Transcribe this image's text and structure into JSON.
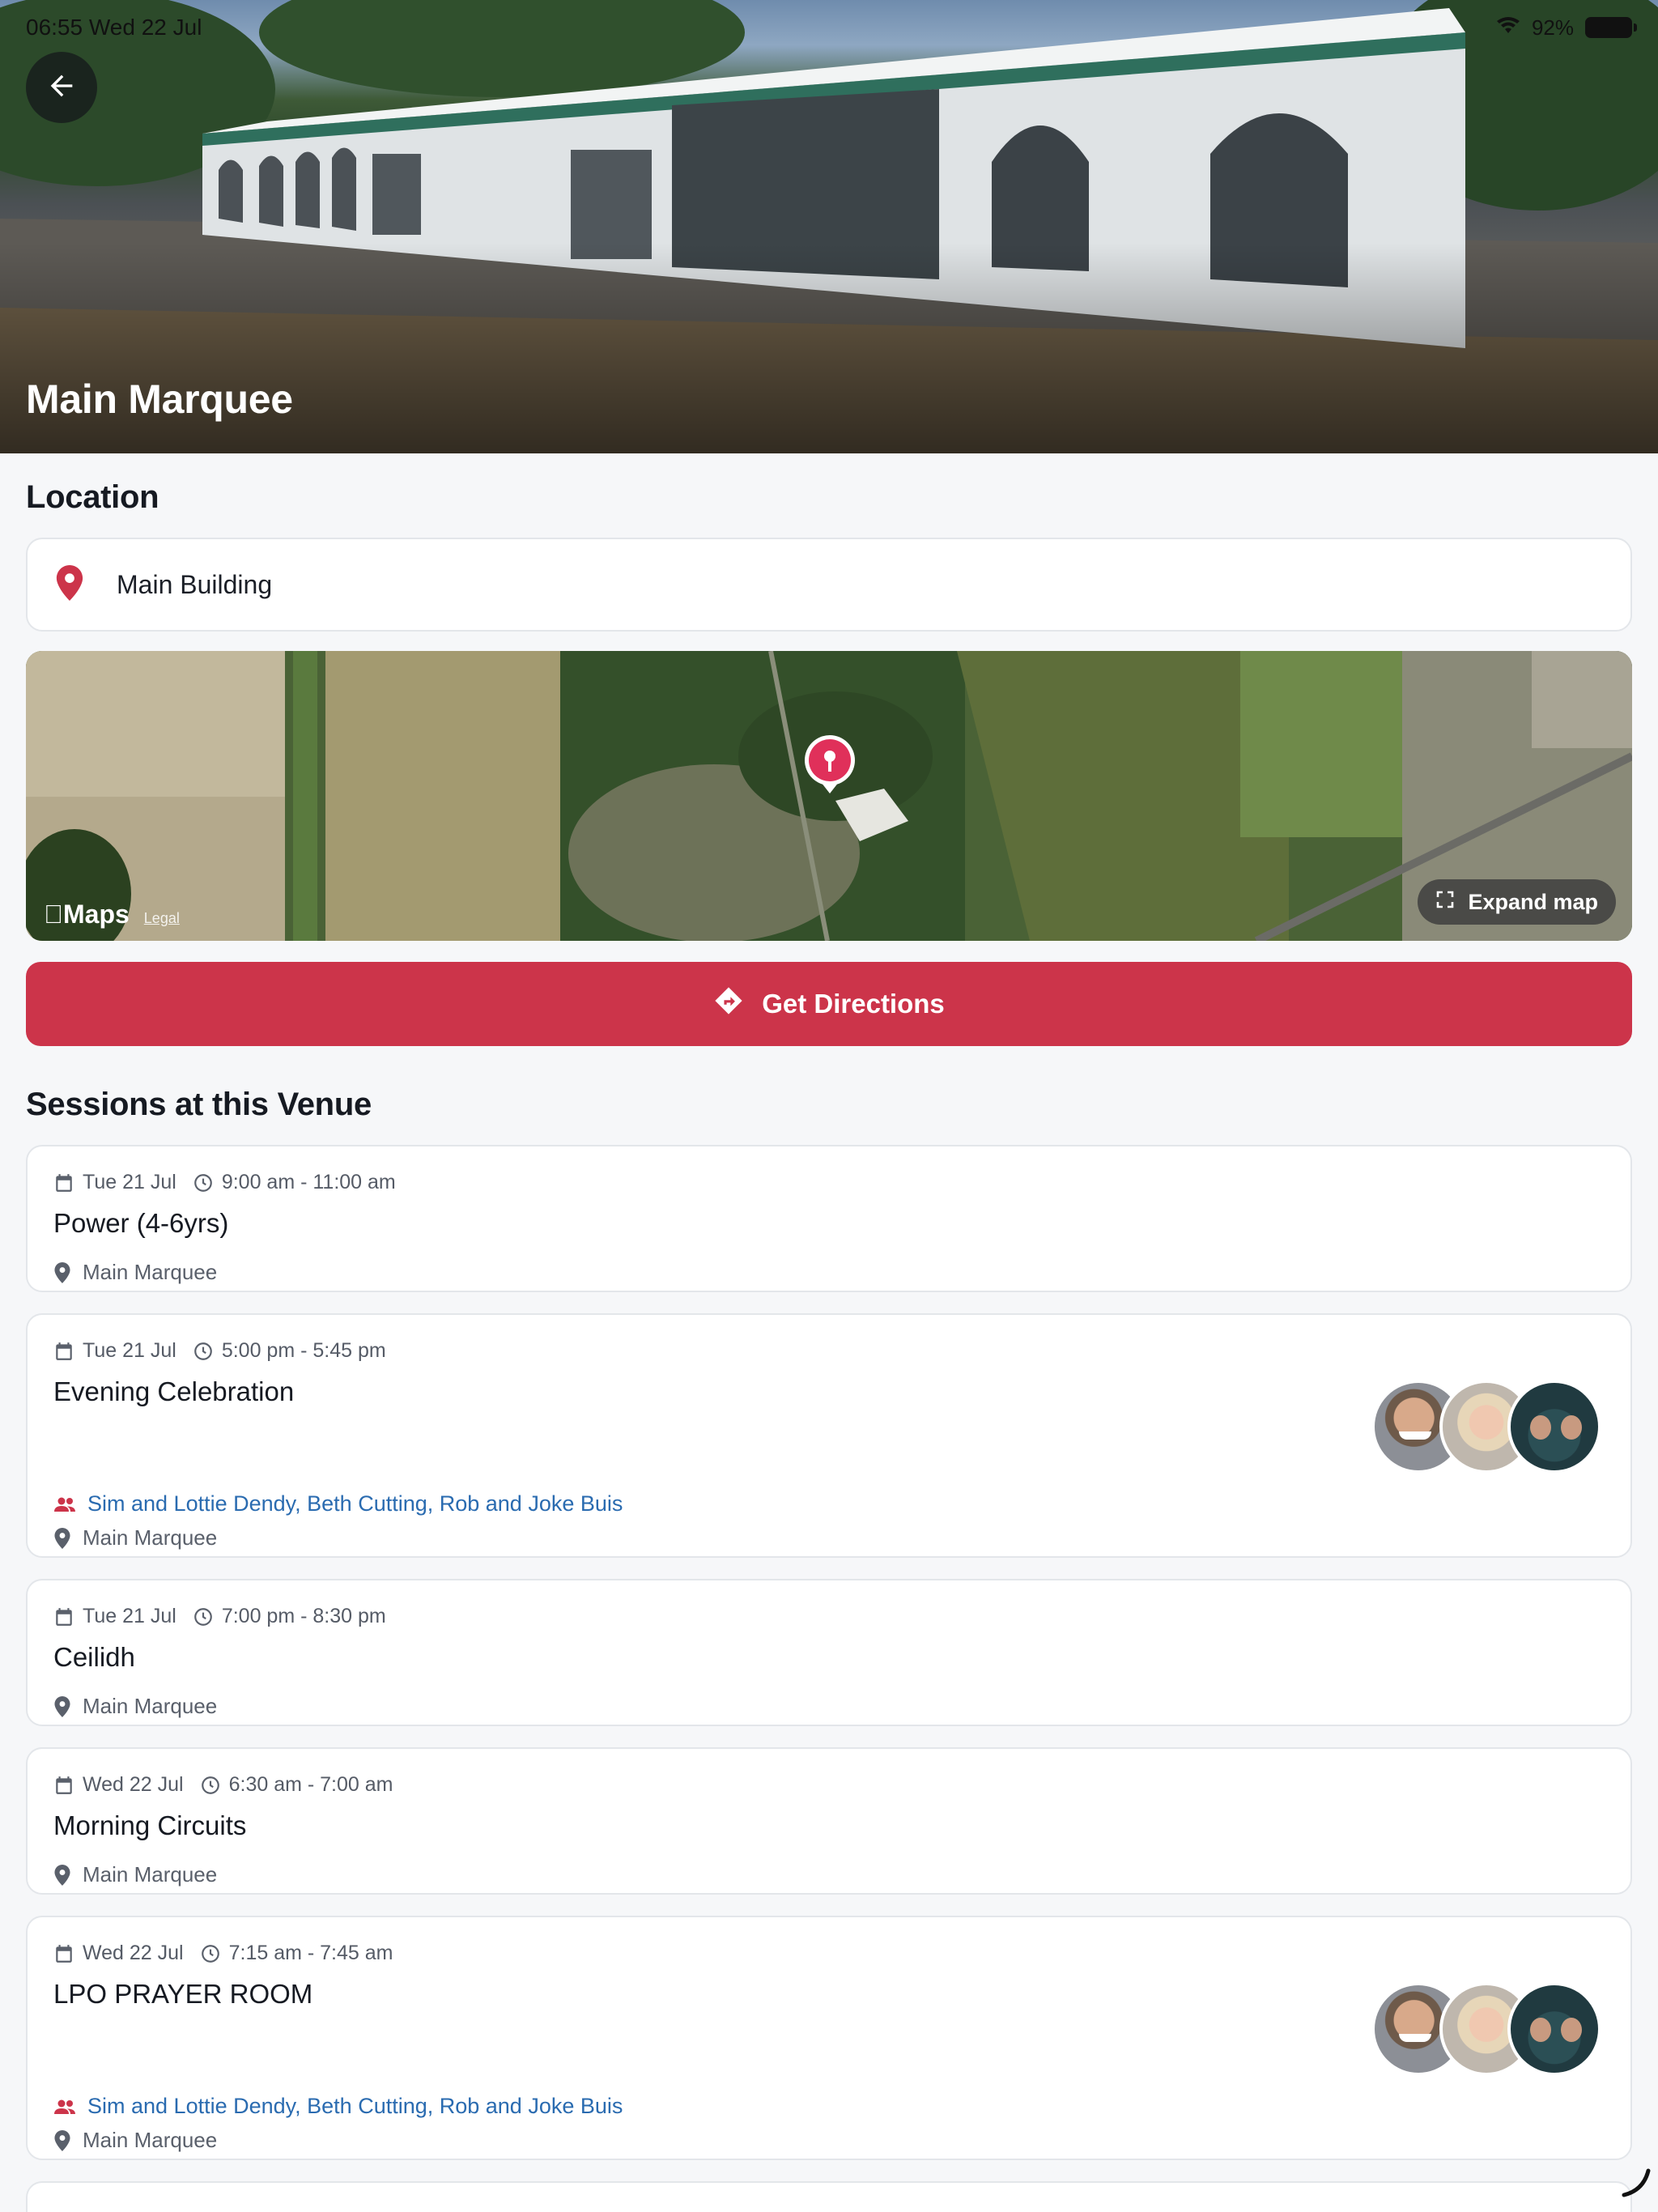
{
  "status_bar": {
    "time_date": "06:55  Wed 22 Jul",
    "battery": "92%"
  },
  "hero": {
    "title": "Main Marquee"
  },
  "location": {
    "section_title": "Location",
    "place": "Main Building",
    "map": {
      "brand": "Maps",
      "legal": "Legal",
      "expand_label": "Expand map"
    }
  },
  "directions": {
    "label": "Get Directions"
  },
  "sessions": {
    "section_title": "Sessions at this Venue",
    "items": [
      {
        "date": "Tue 21 Jul",
        "time": "9:00 am - 11:00 am",
        "title": "Power (4-6yrs)",
        "venue": "Main Marquee"
      },
      {
        "date": "Tue 21 Jul",
        "time": "5:00 pm - 5:45 pm",
        "title": "Evening Celebration",
        "speakers": "Sim and Lottie Dendy, Beth Cutting, Rob and Joke Buis",
        "venue": "Main Marquee"
      },
      {
        "date": "Tue 21 Jul",
        "time": "7:00 pm - 8:30 pm",
        "title": "Ceilidh",
        "venue": "Main Marquee"
      },
      {
        "date": "Wed 22 Jul",
        "time": "6:30 am - 7:00 am",
        "title": "Morning Circuits",
        "venue": "Main Marquee"
      },
      {
        "date": "Wed 22 Jul",
        "time": "7:15 am - 7:45 am",
        "title": "LPO PRAYER ROOM",
        "speakers": "Sim and Lottie Dendy, Beth Cutting, Rob and Joke Buis",
        "venue": "Main Marquee"
      }
    ]
  },
  "colors": {
    "accent": "#cc344a",
    "link": "#2a6bb0",
    "card_border": "#e3e6ea",
    "background": "#f6f7f9"
  }
}
